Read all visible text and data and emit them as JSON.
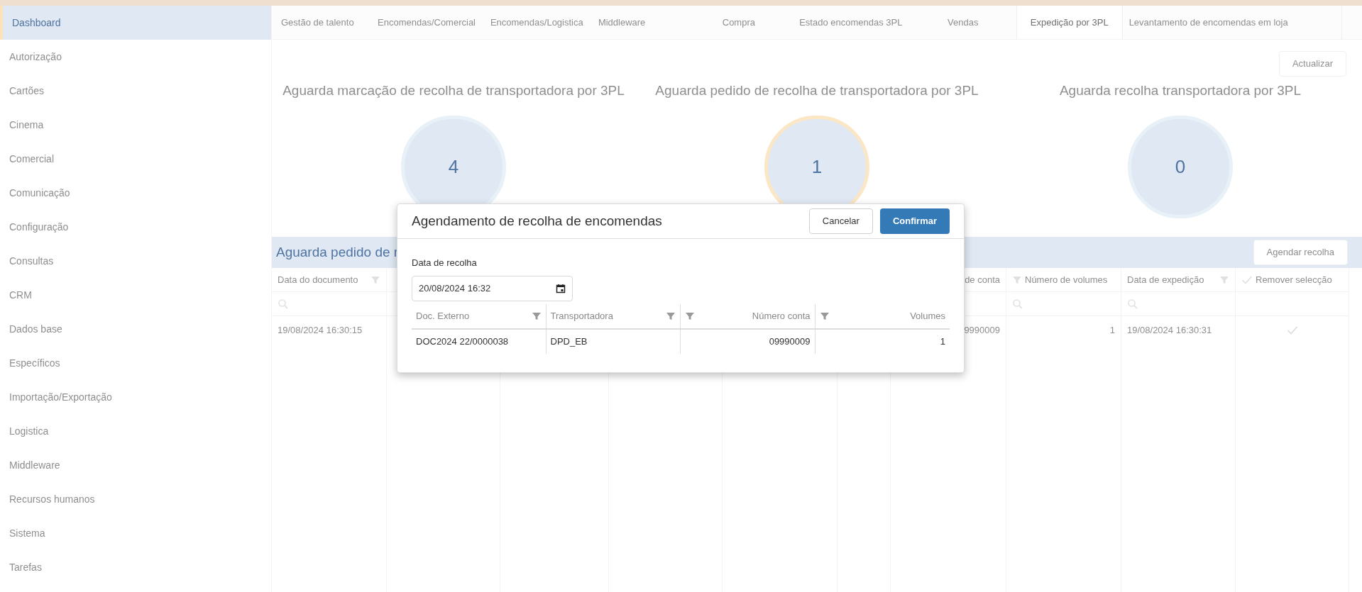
{
  "sidebar": {
    "items": [
      {
        "label": "Dashboard",
        "selected": true
      },
      {
        "label": "Autorização",
        "selected": false
      },
      {
        "label": "Cartões",
        "selected": false
      },
      {
        "label": "Cinema",
        "selected": false
      },
      {
        "label": "Comercial",
        "selected": false
      },
      {
        "label": "Comunicação",
        "selected": false
      },
      {
        "label": "Configuração",
        "selected": false
      },
      {
        "label": "Consultas",
        "selected": false
      },
      {
        "label": "CRM",
        "selected": false
      },
      {
        "label": "Dados base",
        "selected": false
      },
      {
        "label": "Específicos",
        "selected": false
      },
      {
        "label": "Importação/Exportação",
        "selected": false
      },
      {
        "label": "Logistica",
        "selected": false
      },
      {
        "label": "Middleware",
        "selected": false
      },
      {
        "label": "Recursos humanos",
        "selected": false
      },
      {
        "label": "Sistema",
        "selected": false
      },
      {
        "label": "Tarefas",
        "selected": false
      }
    ]
  },
  "tabs": [
    {
      "label": "Gestão de talento",
      "selected": false
    },
    {
      "label": "Encomendas/Comercial",
      "selected": false
    },
    {
      "label": "Encomendas/Logistica",
      "selected": false
    },
    {
      "label": "Middleware",
      "selected": false
    },
    {
      "label": "Compra",
      "selected": false
    },
    {
      "label": "Estado encomendas 3PL",
      "selected": false
    },
    {
      "label": "Vendas",
      "selected": false
    },
    {
      "label": "Expedição por 3PL",
      "selected": true
    },
    {
      "label": "Levantamento de encomendas em loja",
      "selected": false
    }
  ],
  "refresh_button": "Actualizar",
  "gauges": [
    {
      "title": "Aguarda marcação de recolha de transportadora por 3PL",
      "value": "4",
      "color": "#e8f0f8"
    },
    {
      "title": "Aguarda pedido de recolha de transportadora por 3PL",
      "value": "1",
      "color": "#fbe7c6"
    },
    {
      "title": "Aguarda recolha transportadora por 3PL",
      "value": "0",
      "color": "#e8f0f8"
    }
  ],
  "grid": {
    "title": "Aguarda pedido de r",
    "action_button": "Agendar recolha",
    "columns": [
      {
        "label": "Data do documento",
        "kind": "filter_right"
      },
      {
        "kind": "plain"
      },
      {
        "kind": "plain"
      },
      {
        "kind": "plain"
      },
      {
        "kind": "plain"
      },
      {
        "kind": "plain"
      },
      {
        "label": "de conta",
        "kind": "plain"
      },
      {
        "label": "Número de volumes",
        "kind": "filter_left"
      },
      {
        "label": "Data de expedição",
        "kind": "filter_right"
      },
      {
        "label": "Remover selecção",
        "kind": "check"
      }
    ],
    "rows": [
      {
        "cells": [
          "19/08/2024 16:30:15",
          "",
          "",
          "",
          "",
          "",
          "9990009",
          "1",
          "19/08/2024 16:30:31"
        ],
        "checked": true
      }
    ]
  },
  "dialog": {
    "title": "Agendamento de recolha de encomendas",
    "cancel": "Cancelar",
    "confirm": "Confirmar",
    "date_label": "Data de recolha",
    "date_value": "20/08/2024 16:32",
    "columns": [
      {
        "label": "Doc. Externo",
        "kind": "filter_right"
      },
      {
        "label": "Transportadora",
        "kind": "filter_right"
      },
      {
        "label": "Número conta",
        "kind": "filter_left"
      },
      {
        "label": "Volumes",
        "kind": "filter_left"
      }
    ],
    "rows": [
      {
        "cells": [
          "DOC2024 22/0000038",
          "DPD_EB",
          "09990009",
          "1"
        ]
      }
    ]
  }
}
